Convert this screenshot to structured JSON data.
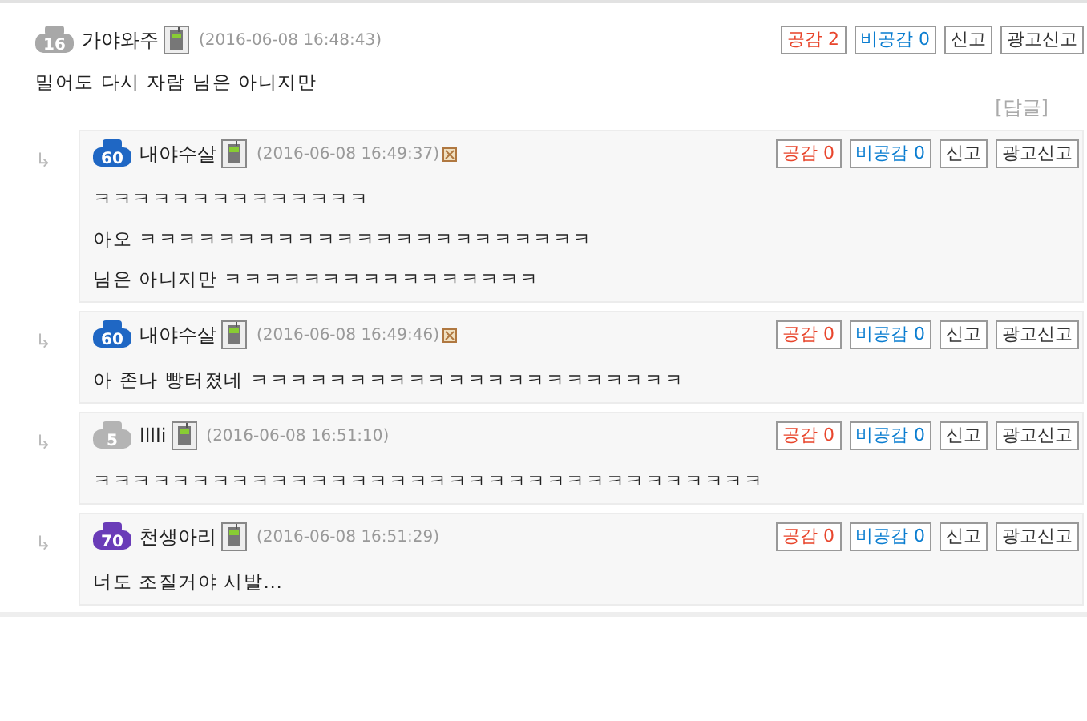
{
  "comment": {
    "level": "16",
    "color": "#a8a8a8",
    "author": "가야와주",
    "mobile": true,
    "time": "(2016-06-08 16:48:43)",
    "delete_mark": false,
    "buttons": {
      "like": "공감 2",
      "dislike": "비공감 0",
      "report": "신고",
      "ad_report": "광고신고"
    },
    "lines": [
      "밀어도 다시 자람 님은 아니지만"
    ],
    "reply_link": "[답글]"
  },
  "replies": [
    {
      "arrow": "↳",
      "level": "60",
      "color": "#1f67c4",
      "author": "내야수살",
      "mobile": true,
      "time": "(2016-06-08 16:49:37)",
      "delete_mark": true,
      "buttons": {
        "like": "공감 0",
        "dislike": "비공감 0",
        "report": "신고",
        "ad_report": "광고신고"
      },
      "lines": [
        "ㅋㅋㅋㅋㅋㅋㅋㅋㅋㅋㅋㅋㅋㅋ",
        "아오 ㅋㅋㅋㅋㅋㅋㅋㅋㅋㅋㅋㅋㅋㅋㅋㅋㅋㅋㅋㅋㅋㅋㅋ",
        "님은 아니지만 ㅋㅋㅋㅋㅋㅋㅋㅋㅋㅋㅋㅋㅋㅋㅋㅋ"
      ]
    },
    {
      "arrow": "↳",
      "level": "60",
      "color": "#1f67c4",
      "author": "내야수살",
      "mobile": true,
      "time": "(2016-06-08 16:49:46)",
      "delete_mark": true,
      "buttons": {
        "like": "공감 0",
        "dislike": "비공감 0",
        "report": "신고",
        "ad_report": "광고신고"
      },
      "lines": [
        "아 존나 빵터졌네 ㅋㅋㅋㅋㅋㅋㅋㅋㅋㅋㅋㅋㅋㅋㅋㅋㅋㅋㅋㅋㅋㅋ"
      ]
    },
    {
      "arrow": "↳",
      "level": "5",
      "color": "#b4b4b4",
      "author": "lllli",
      "mobile": true,
      "time": "(2016-06-08 16:51:10)",
      "delete_mark": false,
      "buttons": {
        "like": "공감 0",
        "dislike": "비공감 0",
        "report": "신고",
        "ad_report": "광고신고"
      },
      "lines": [
        "ㅋㅋㅋㅋㅋㅋㅋㅋㅋㅋㅋㅋㅋㅋㅋㅋㅋㅋㅋㅋㅋㅋㅋㅋㅋㅋㅋㅋㅋㅋㅋㅋㅋㅋ"
      ]
    },
    {
      "arrow": "↳",
      "level": "70",
      "color": "#6a3cb8",
      "author": "천생아리",
      "mobile": true,
      "time": "(2016-06-08 16:51:29)",
      "delete_mark": false,
      "buttons": {
        "like": "공감 0",
        "dislike": "비공감 0",
        "report": "신고",
        "ad_report": "광고신고"
      },
      "lines": [
        "너도 조질거야 시발..."
      ]
    }
  ]
}
